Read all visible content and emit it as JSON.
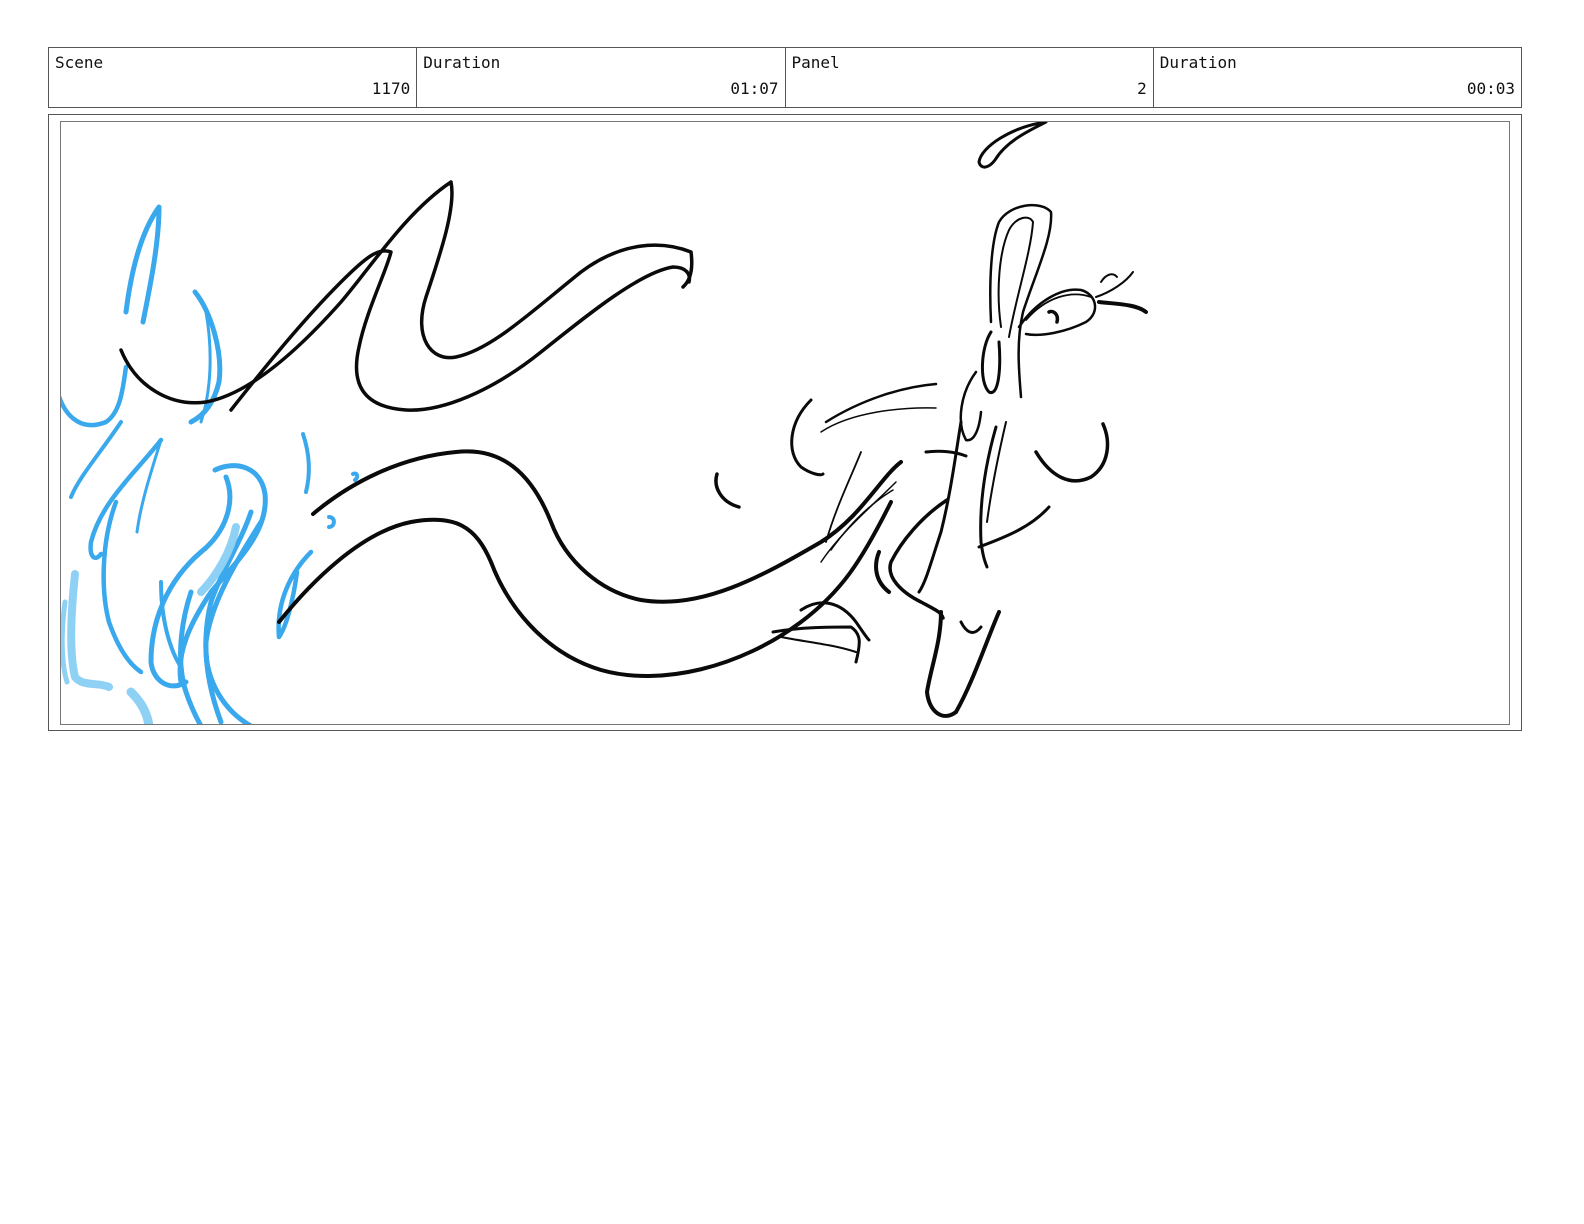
{
  "header": {
    "scene_label": "Scene",
    "scene_value": "1170",
    "scene_duration_label": "Duration",
    "scene_duration_value": "01:07",
    "panel_label": "Panel",
    "panel_value": "2",
    "panel_duration_label": "Duration",
    "panel_duration_value": "00:03"
  },
  "colors": {
    "ink": "#0a0a0a",
    "flame_blue": "#3aa8ec",
    "flame_light_blue": "#8fd0f5",
    "border": "#555555"
  }
}
